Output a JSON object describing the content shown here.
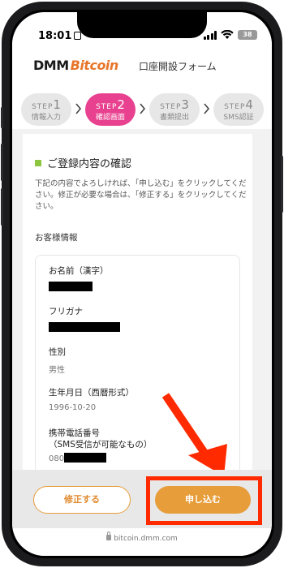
{
  "status_bar": {
    "time": "18:01",
    "battery": "38"
  },
  "header": {
    "logo_dmm": "DMM",
    "logo_bitcoin": "Bitcoin",
    "title": "口座開設フォーム"
  },
  "steps": [
    {
      "label": "STEP",
      "num": "1",
      "sub": "情報入力",
      "active": false
    },
    {
      "label": "STEP",
      "num": "2",
      "sub": "確認画面",
      "active": true
    },
    {
      "label": "STEP",
      "num": "3",
      "sub": "書類提出",
      "active": false
    },
    {
      "label": "STEP",
      "num": "4",
      "sub": "SMS認証",
      "active": false
    }
  ],
  "confirm": {
    "title": "ご登録内容の確認",
    "description": "下記の内容でよろしければ、「申し込む」をクリックしてください。修正が必要な場合は、「修正する」をクリックしてください。",
    "section_label": "お客様情報"
  },
  "fields": {
    "name_kanji": {
      "label": "お名前（漢字）",
      "value": ""
    },
    "furigana": {
      "label": "フリガナ",
      "value": ""
    },
    "gender": {
      "label": "性別",
      "value": "男性"
    },
    "birthdate": {
      "label": "生年月日（西暦形式）",
      "value": "1996-10-20"
    },
    "phone": {
      "label_line1": "携帯電話番号",
      "label_line2": "（SMS受信が可能なもの）",
      "value_prefix": "080"
    }
  },
  "buttons": {
    "fix": "修正する",
    "apply": "申し込む"
  },
  "browser": {
    "url": "bitcoin.dmm.com"
  },
  "colors": {
    "accent_pink": "#e8418f",
    "accent_orange": "#e79d3a",
    "highlight_red": "#ff2a00",
    "marker_green": "#8cc63f"
  }
}
